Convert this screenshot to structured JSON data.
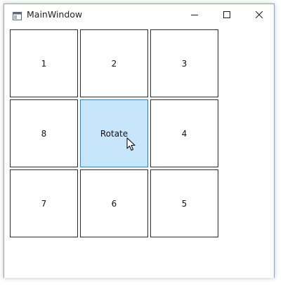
{
  "window": {
    "title": "MainWindow",
    "icon": "window-app-icon",
    "controls": {
      "minimize_icon": "minimize-icon",
      "maximize_icon": "maximize-icon",
      "close_icon": "close-icon"
    }
  },
  "grid": {
    "tiles": [
      {
        "label": "1"
      },
      {
        "label": "2"
      },
      {
        "label": "3"
      },
      {
        "label": "8"
      },
      {
        "label": "Rotate"
      },
      {
        "label": "4"
      },
      {
        "label": "7"
      },
      {
        "label": "6"
      },
      {
        "label": "5"
      }
    ]
  },
  "colors": {
    "hover_fill": "#c7e6fb",
    "hover_border": "#3c7fb1",
    "tile_border": "#2b2b2b"
  }
}
